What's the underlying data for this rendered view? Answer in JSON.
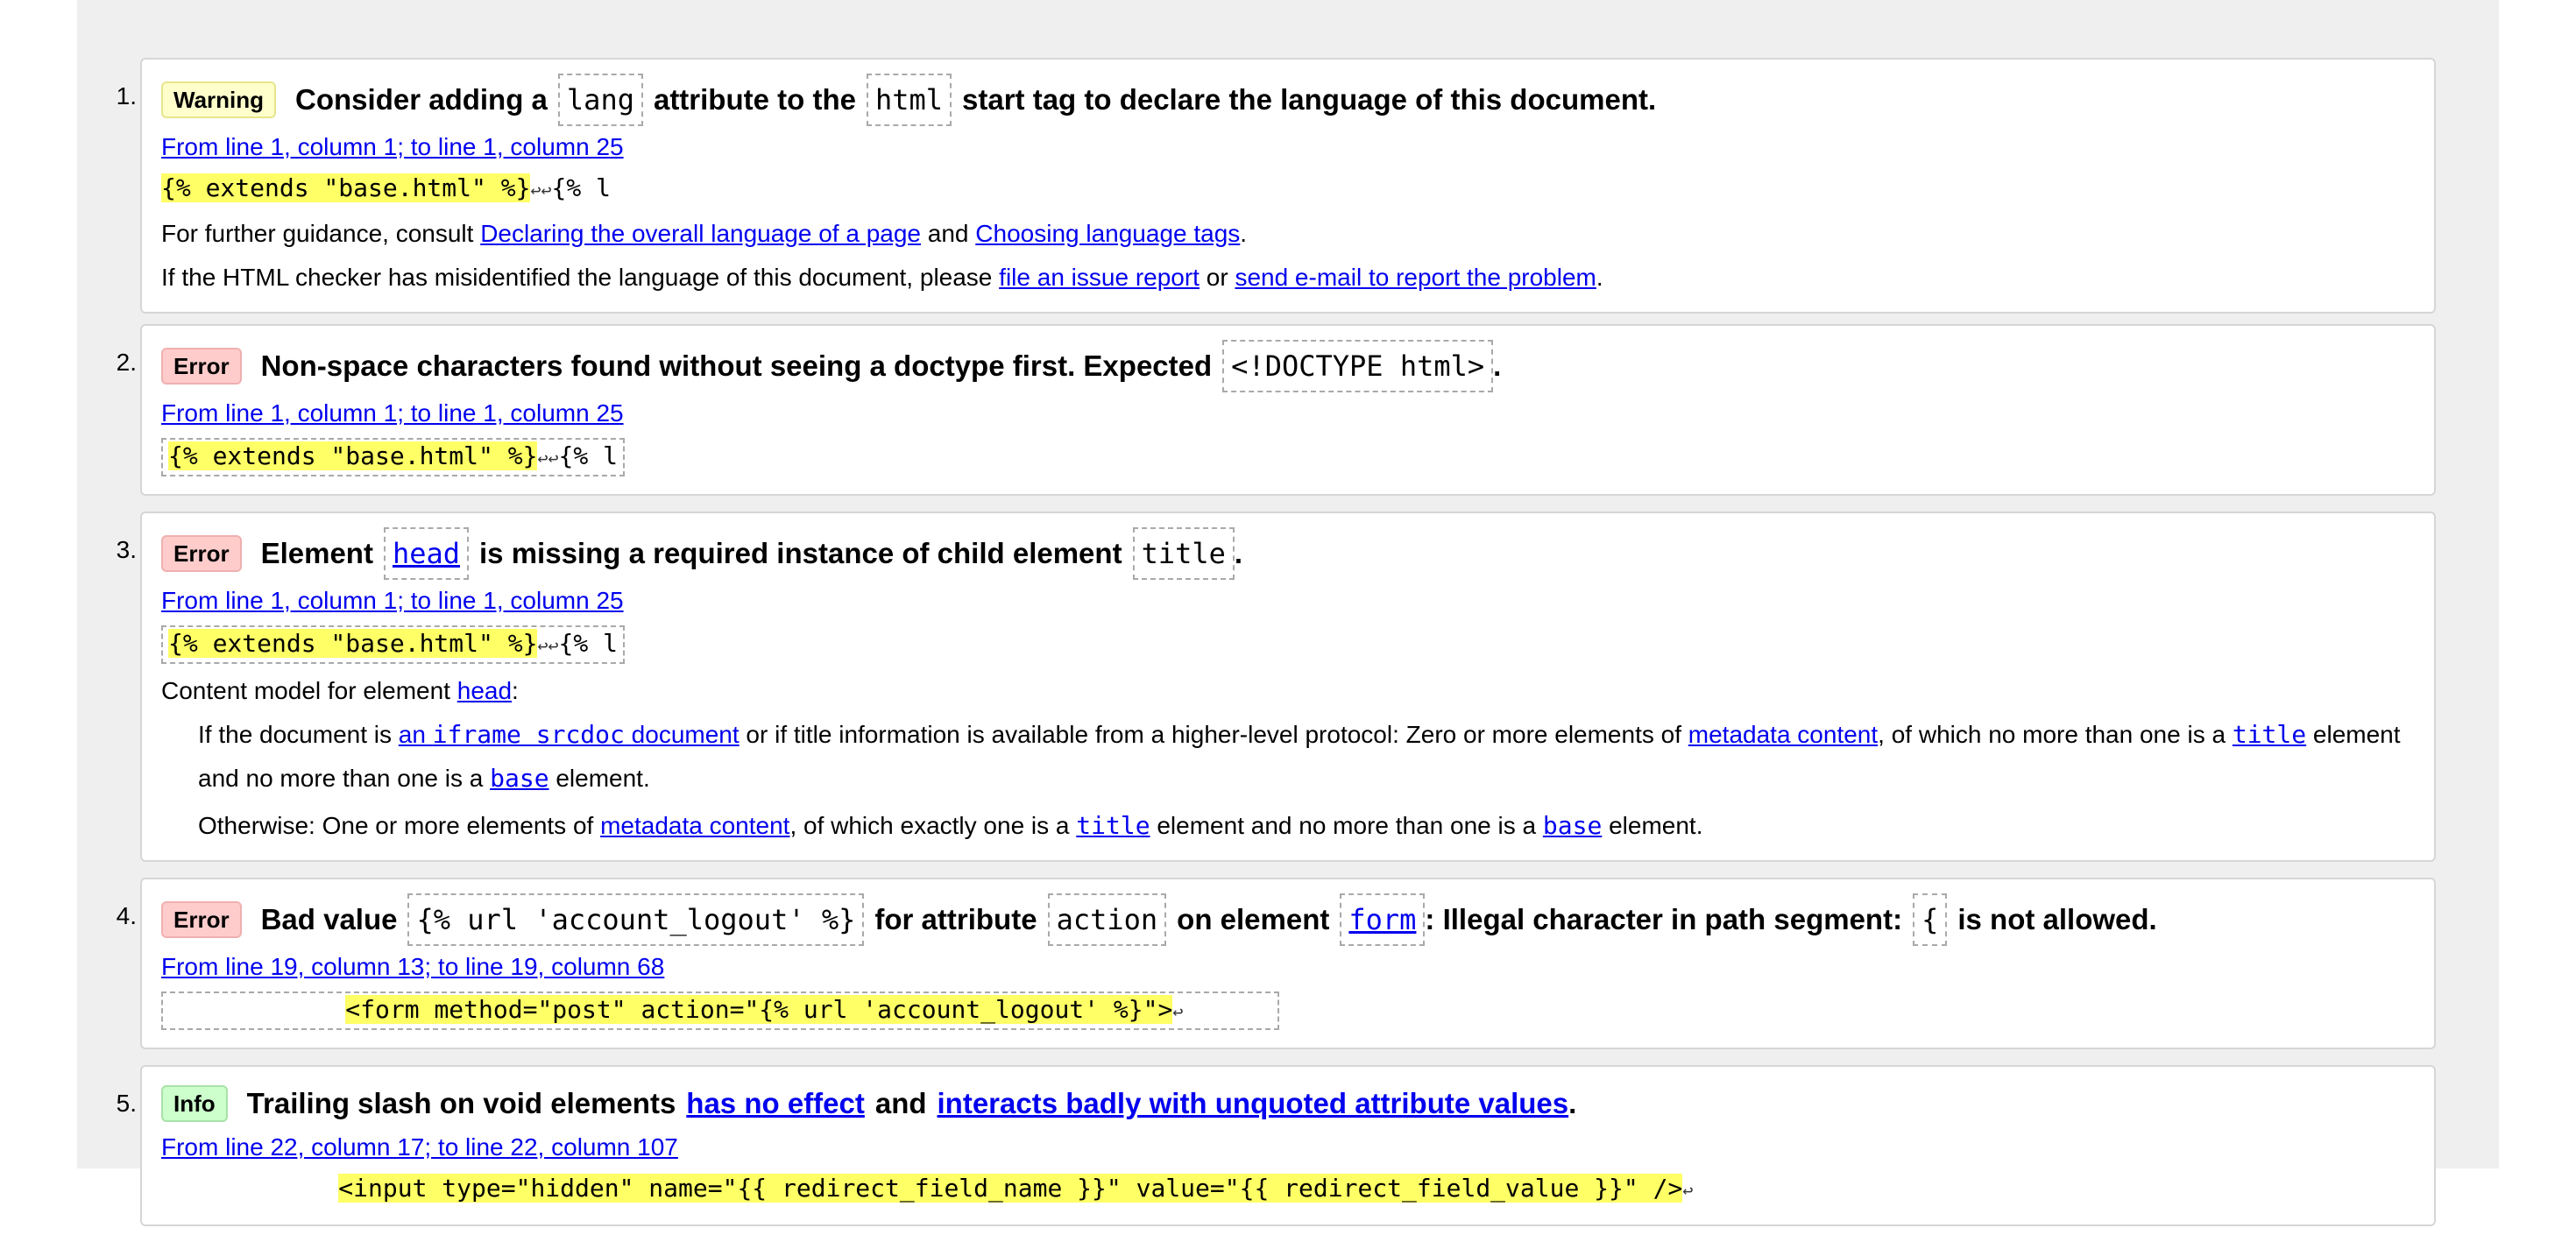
{
  "messages": [
    {
      "number": "1.",
      "badge": "Warning",
      "title": {
        "t1": "Consider adding a",
        "c1": "lang",
        "t2": "attribute to the",
        "c2": "html",
        "t3": "start tag to declare the language of this document."
      },
      "location": "From line 1, column 1; to line 1, column 25",
      "extract": {
        "highlight": "{% extends \"base.html\" %}",
        "returns": "↩↩",
        "rest": "{% l"
      },
      "guidance": {
        "prefix": "For further guidance, consult",
        "link1": "Declaring the overall language of a page",
        "and": "and",
        "link2": "Choosing language tags",
        "suffix": "."
      },
      "misidentified": {
        "prefix": "If the HTML checker has misidentified the language of this document, please",
        "link1": "file an issue report",
        "or": "or",
        "link2": "send e-mail to report the problem",
        "suffix": "."
      }
    },
    {
      "number": "2.",
      "badge": "Error",
      "title": {
        "t1": "Non-space characters found without seeing a doctype first. Expected",
        "c1": "<!DOCTYPE html>",
        "t2": "."
      },
      "location": "From line 1, column 1; to line 1, column 25",
      "extract": {
        "highlight": "{% extends \"base.html\" %}",
        "returns": "↩↩",
        "rest": "{% l"
      }
    },
    {
      "number": "3.",
      "badge": "Error",
      "title": {
        "t1": "Element",
        "c1": "head",
        "t2": "is missing a required instance of child element",
        "c2": "title",
        "t3": "."
      },
      "location": "From line 1, column 1; to line 1, column 25",
      "extract": {
        "highlight": "{% extends \"base.html\" %}",
        "returns": "↩↩",
        "rest": "{% l"
      },
      "content_model": {
        "prefix": "Content model for element",
        "element": "head",
        "suffix": ":"
      },
      "rule1": {
        "a": "If the document is",
        "link_pre": "an",
        "link_code": "iframe srcdoc",
        "link_post": "document",
        "b": "or if title information is available from a higher-level protocol: Zero or more elements of",
        "metadata": "metadata content",
        "c": ", of which no more than one is a",
        "title": "title",
        "d": "element and no more than one is a",
        "base": "base",
        "e": "element."
      },
      "rule2": {
        "a": "Otherwise: One or more elements of",
        "metadata": "metadata content",
        "b": ", of which exactly one is a",
        "title": "title",
        "c": "element and no more than one is a",
        "base": "base",
        "d": "element."
      }
    },
    {
      "number": "4.",
      "badge": "Error",
      "title": {
        "t1": "Bad value",
        "c1": "{% url 'account_logout' %}",
        "t2": "for attribute",
        "c2": "action",
        "t3": "on element",
        "c3": "form",
        "t4": ": Illegal character in path segment:",
        "c4": "{",
        "t5": "is not allowed."
      },
      "location": "From line 19, column 13; to line 19, column 68",
      "extract": {
        "lead": "            ",
        "highlight": "<form method=\"post\" action=\"{% url 'account_logout' %}\">",
        "returns": "↩",
        "rest": "      "
      }
    },
    {
      "number": "5.",
      "badge": "Info",
      "title": {
        "t1": "Trailing slash on void elements",
        "link1": "has no effect",
        "t2": "and",
        "link2": "interacts badly with unquoted attribute values",
        "t3": "."
      },
      "location": "From line 22, column 17; to line 22, column 107",
      "extract": {
        "lead": "            ",
        "highlight": "<input type=\"hidden\" name=\"{{ redirect_field_name }}\" value=\"{{ redirect_field_value }}\" />",
        "returns": "↩",
        "rest": ""
      }
    }
  ]
}
